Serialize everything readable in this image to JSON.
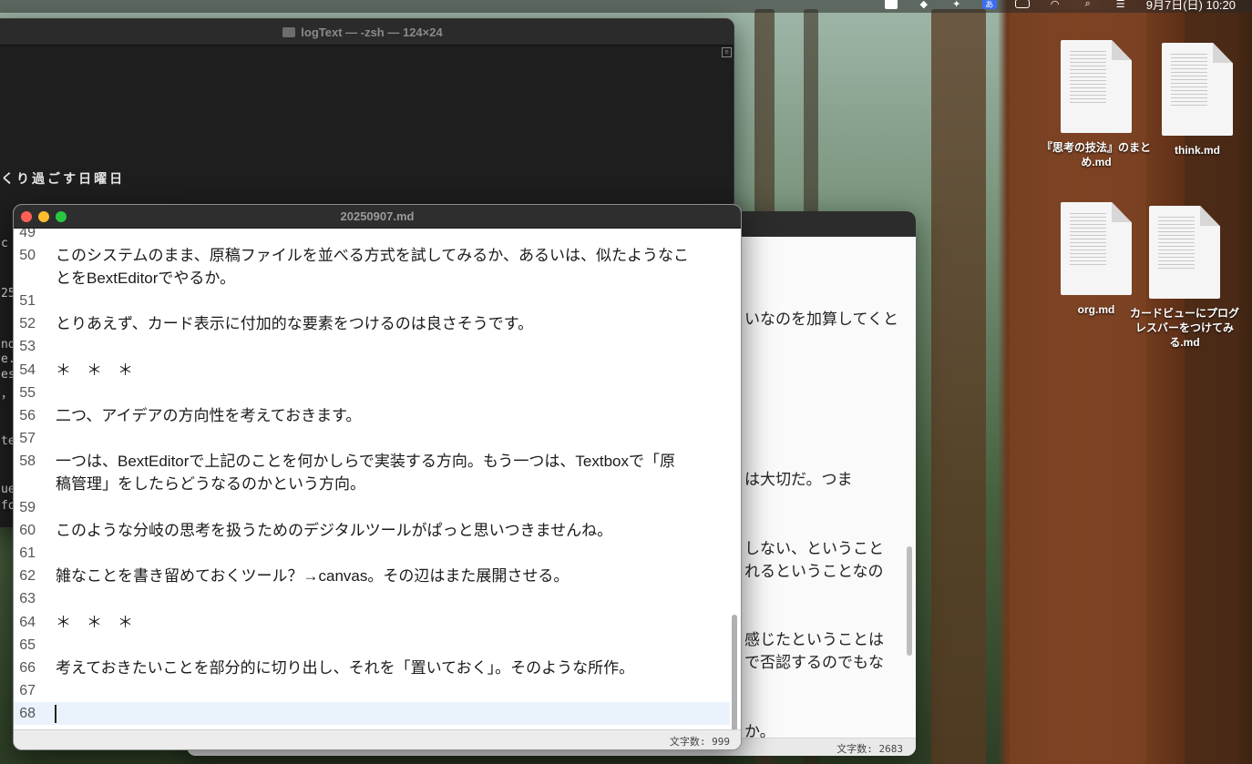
{
  "menubar": {
    "datetime": "9月7日(日) 10:20",
    "ime_label": "あ"
  },
  "terminal": {
    "title": "logText — -zsh — 124×24",
    "visible_line": "くり過ごす日曜日",
    "fragments": [
      "c",
      "25",
      "nd",
      "e.",
      "es",
      "，",
      "te",
      "ue",
      "fo"
    ]
  },
  "editor_back": {
    "visible_fragments": [
      "いなのを加算してくと",
      "は大切だ。つま",
      "しない、ということ",
      "れるということなの",
      "感じたということは",
      "で否認するのでもな",
      "か。"
    ],
    "char_count": "文字数: 2683"
  },
  "editor": {
    "title": "20250907.md",
    "lines": [
      {
        "num": "49",
        "text": ""
      },
      {
        "num": "50",
        "text": "このシステムのまま、原稿ファイルを並べる方式を試してみるか、あるいは、似たようなこ"
      },
      {
        "num": "",
        "text": "とをBextEditorでやるか。"
      },
      {
        "num": "51",
        "text": ""
      },
      {
        "num": "52",
        "text": "とりあえず、カード表示に付加的な要素をつけるのは良さそうです。"
      },
      {
        "num": "53",
        "text": ""
      },
      {
        "num": "54",
        "text": "＊　＊　＊"
      },
      {
        "num": "55",
        "text": ""
      },
      {
        "num": "56",
        "text": "二つ、アイデアの方向性を考えておきます。"
      },
      {
        "num": "57",
        "text": ""
      },
      {
        "num": "58",
        "text": "一つは、BextEditorで上記のことを何かしらで実装する方向。もう一つは、Textboxで「原"
      },
      {
        "num": "",
        "text": "稿管理」をしたらどうなるのかという方向。"
      },
      {
        "num": "59",
        "text": ""
      },
      {
        "num": "60",
        "text": "このような分岐の思考を扱うためのデジタルツールがぱっと思いつきませんね。"
      },
      {
        "num": "61",
        "text": ""
      },
      {
        "num": "62",
        "text": "雑なことを書き留めておくツール？→canvas。その辺はまた展開させる。"
      },
      {
        "num": "63",
        "text": ""
      },
      {
        "num": "64",
        "text": "＊　＊　＊"
      },
      {
        "num": "65",
        "text": ""
      },
      {
        "num": "66",
        "text": "考えておきたいことを部分的に切り出し、それを「置いておく」。そのような所作。"
      },
      {
        "num": "67",
        "text": ""
      },
      {
        "num": "68",
        "text": ""
      }
    ],
    "char_count": "文字数: 999"
  },
  "desktop_icons": [
    {
      "label": "『思考の技法』のまとめ.md",
      "icon": "document-icon"
    },
    {
      "label": "think.md",
      "icon": "document-icon"
    },
    {
      "label": "org.md",
      "icon": "document-icon"
    },
    {
      "label": "カードビューにプログレスバーをつけてみる.md",
      "icon": "document-icon"
    }
  ],
  "colors": {
    "close": "#ff5f57",
    "minimize": "#febc2e",
    "maximize": "#28c840",
    "current_line": "#eaf3fc"
  }
}
